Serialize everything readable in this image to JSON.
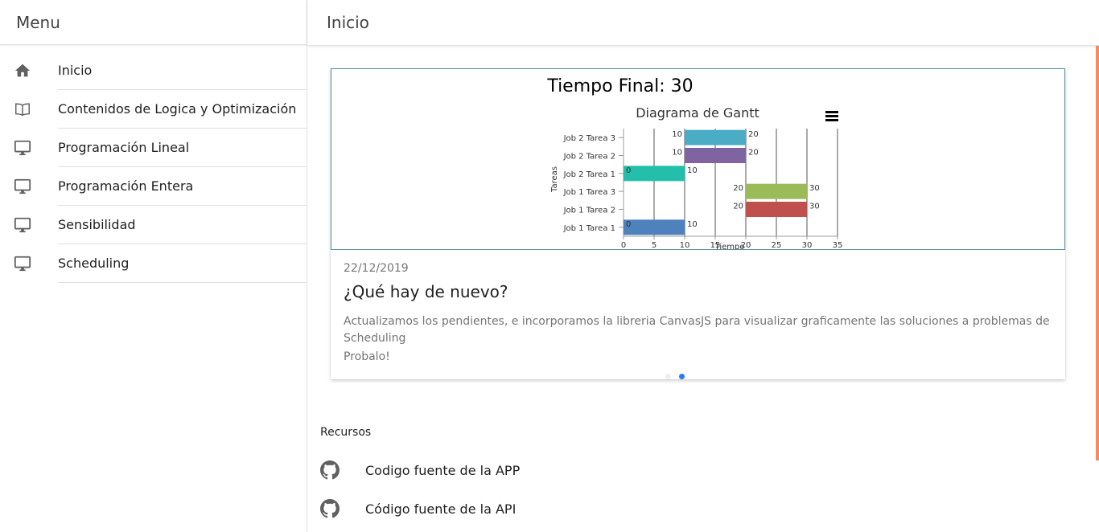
{
  "sidebar": {
    "title": "Menu",
    "items": [
      {
        "label": "Inicio",
        "icon": "home-icon"
      },
      {
        "label": "Contenidos de Logica y Optimización",
        "icon": "book-icon"
      },
      {
        "label": "Programación Lineal",
        "icon": "monitor-icon"
      },
      {
        "label": "Programación Entera",
        "icon": "monitor-icon"
      },
      {
        "label": "Sensibilidad",
        "icon": "monitor-icon"
      },
      {
        "label": "Scheduling",
        "icon": "monitor-icon"
      }
    ]
  },
  "topbar": {
    "title": "Inicio"
  },
  "card": {
    "chart_heading": "Tiempo Final: 30",
    "date": "22/12/2019",
    "title": "¿Qué hay de nuevo?",
    "body_line1": "Actualizamos los pendientes, e incorporamos la libreria CanvasJS para visualizar graficamente las soluciones a problemas de Scheduling",
    "body_line2": "Probalo!"
  },
  "chart_data": {
    "type": "bar",
    "orientation": "horizontal-range",
    "title": "Diagrama de Gantt",
    "xlabel": "Tiempo",
    "ylabel": "Tareas",
    "xlim": [
      0,
      35
    ],
    "xticks": [
      0,
      5,
      10,
      15,
      20,
      25,
      30,
      35
    ],
    "grid": true,
    "categories": [
      "Job 1 Tarea 1",
      "Job 1 Tarea 2",
      "Job 1 Tarea 3",
      "Job 2 Tarea 1",
      "Job 2 Tarea 2",
      "Job 2 Tarea 3"
    ],
    "ranges": [
      {
        "task": "Job 1 Tarea 1",
        "start": 0,
        "end": 10,
        "color": "#4f81bc"
      },
      {
        "task": "Job 1 Tarea 2",
        "start": 20,
        "end": 30,
        "color": "#c0504e"
      },
      {
        "task": "Job 1 Tarea 3",
        "start": 20,
        "end": 30,
        "color": "#9bbb58"
      },
      {
        "task": "Job 2 Tarea 1",
        "start": 0,
        "end": 10,
        "color": "#23bfaa"
      },
      {
        "task": "Job 2 Tarea 2",
        "start": 10,
        "end": 20,
        "color": "#8064a1"
      },
      {
        "task": "Job 2 Tarea 3",
        "start": 10,
        "end": 20,
        "color": "#4aacc5"
      }
    ]
  },
  "carousel": {
    "count": 2,
    "active": 2
  },
  "resources": {
    "title": "Recursos",
    "items": [
      {
        "label": "Codigo fuente de la APP",
        "icon": "github-icon"
      },
      {
        "label": "Código fuente de la API",
        "icon": "github-icon"
      }
    ]
  },
  "colors": {
    "accent": "#2979ff",
    "scrollbar": "#f28c63",
    "frame": "#5b8fa0"
  }
}
